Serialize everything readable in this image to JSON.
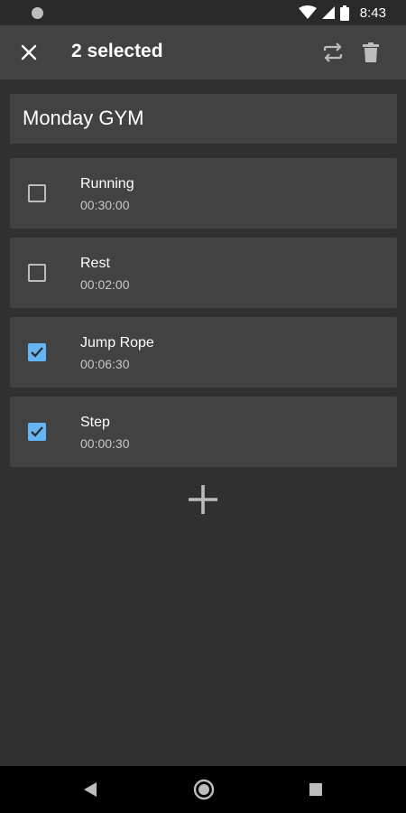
{
  "status_bar": {
    "time": "8:43",
    "icons": [
      "notification-dot-icon",
      "wifi-icon",
      "signal-icon",
      "battery-icon"
    ]
  },
  "action_bar": {
    "selected_label": "2 selected",
    "icons": [
      "close-icon",
      "repeat-icon",
      "delete-icon"
    ]
  },
  "workout": {
    "name": "Monday GYM"
  },
  "exercises": [
    {
      "name": "Running",
      "duration": "00:30:00",
      "checked": false
    },
    {
      "name": "Rest",
      "duration": "00:02:00",
      "checked": false
    },
    {
      "name": "Jump Rope",
      "duration": "00:06:30",
      "checked": true
    },
    {
      "name": "Step",
      "duration": "00:00:30",
      "checked": true
    }
  ],
  "add_button_icon": "plus-icon",
  "nav_bar": {
    "icons": [
      "back-icon",
      "home-icon",
      "recents-icon"
    ]
  },
  "colors": {
    "background": "#303030",
    "card": "#424242",
    "accent": "#64b5f6"
  }
}
